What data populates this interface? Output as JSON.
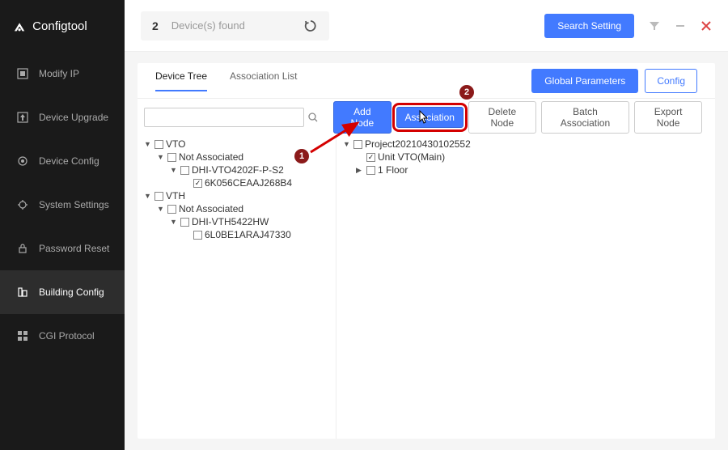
{
  "app_name": "Configtool",
  "topbar": {
    "device_count": "2",
    "device_label": "Device(s) found",
    "search_setting": "Search Setting"
  },
  "sidebar": {
    "items": [
      {
        "label": "Modify IP"
      },
      {
        "label": "Device Upgrade"
      },
      {
        "label": "Device Config"
      },
      {
        "label": "System Settings"
      },
      {
        "label": "Password Reset"
      },
      {
        "label": "Building Config"
      },
      {
        "label": "CGI Protocol"
      }
    ]
  },
  "tabs": {
    "device_tree": "Device Tree",
    "assoc_list": "Association List",
    "global_params": "Global Parameters",
    "config": "Config"
  },
  "toolbar": {
    "search_placeholder": "",
    "add_node": "Add Node",
    "association": "Association",
    "delete_node": "Delete Node",
    "batch_assoc": "Batch Association",
    "export_node": "Export Node"
  },
  "left_tree": {
    "n0": "VTO",
    "n1": "Not Associated",
    "n2": "DHI-VTO4202F-P-S2",
    "n3": "6K056CEAAJ268B4",
    "n4": "VTH",
    "n5": "Not Associated",
    "n6": "DHI-VTH5422HW",
    "n7": "6L0BE1ARAJ47330"
  },
  "right_tree": {
    "n0": "Project20210430102552",
    "n1": "Unit VTO(Main)",
    "n2": "1 Floor"
  },
  "badges": {
    "one": "1",
    "two": "2"
  }
}
